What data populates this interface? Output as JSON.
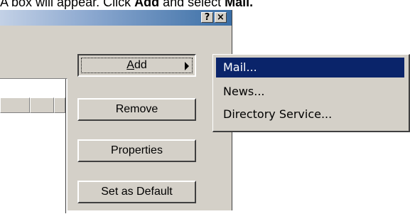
{
  "instruction": {
    "prefix": "A box will appear. Click ",
    "add": "Add",
    "middle": " and select ",
    "mail": "Mail."
  },
  "titlebar": {
    "help": "?",
    "close": "×"
  },
  "buttons": {
    "add": "Add",
    "add_mnemonic": "A",
    "add_rest": "dd",
    "remove": "Remove",
    "properties": "Properties",
    "set_default": "Set as Default"
  },
  "menu": {
    "items": [
      {
        "label": "Mail...",
        "selected": true
      },
      {
        "label": "News..."
      },
      {
        "label": "Directory Service..."
      }
    ]
  },
  "colors": {
    "face": "#d4d0c8",
    "highlight": "#0a246a"
  },
  "icons": [
    "help-icon",
    "close-icon",
    "submenu-arrow-icon"
  ]
}
